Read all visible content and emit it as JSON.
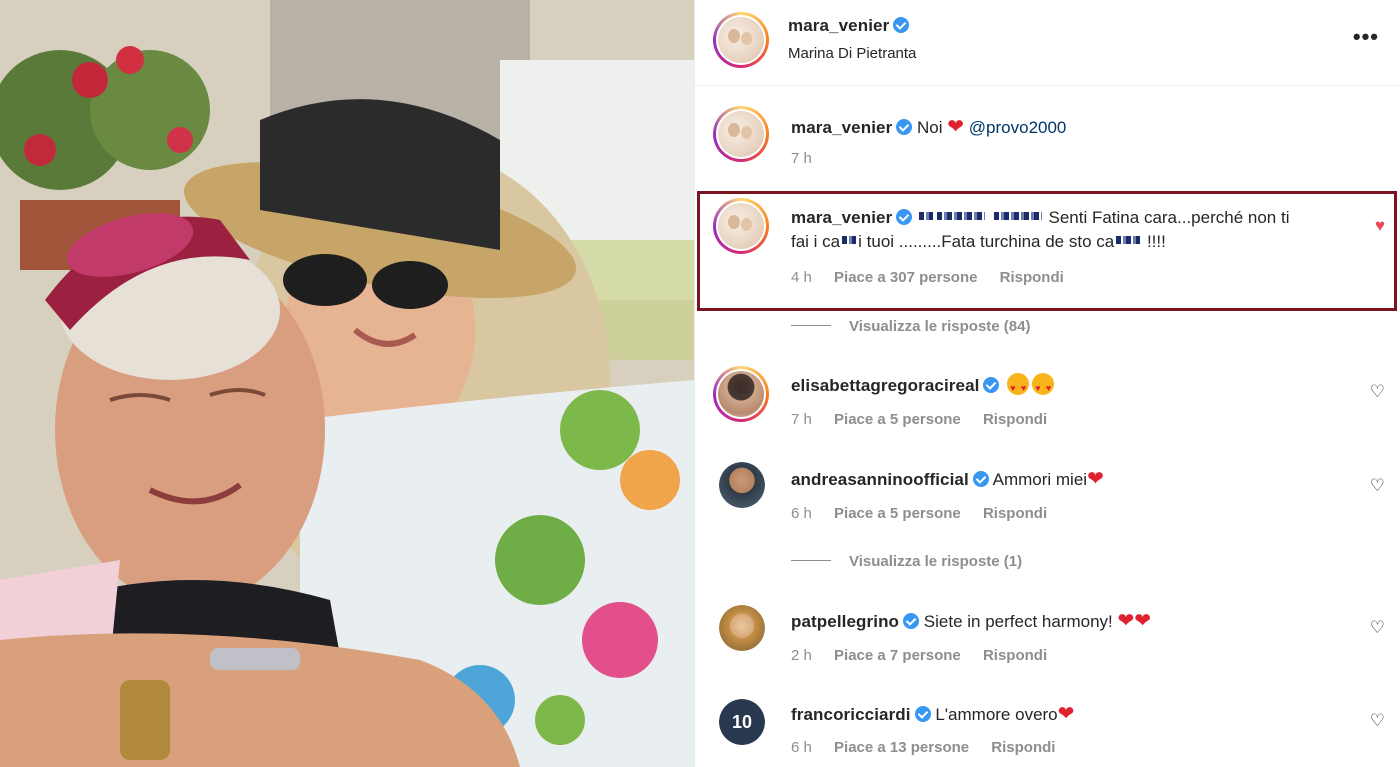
{
  "post": {
    "author": "mara_venier",
    "location": "Marina Di Pietranta",
    "more_label": "•••"
  },
  "comments": [
    {
      "user": "mara_venier",
      "text": "Noi",
      "mention": "@provo2000",
      "time": "7 h"
    },
    {
      "user": "mara_venier",
      "text_1": "Senti Fatina cara...perché non ti",
      "text_2a": "fai i ca",
      "text_2b": "i tuoi .........Fata turchina de sto ca",
      "text_2c": "!!!!",
      "time": "4 h",
      "likes": "Piace a 307 persone",
      "reply": "Rispondi",
      "view_replies": "Visualizza le risposte (84)"
    },
    {
      "user": "elisabettagregoracireal",
      "time": "7 h",
      "likes": "Piace a 5 persone",
      "reply": "Rispondi"
    },
    {
      "user": "andreasanninoofficial",
      "text": "Ammori miei",
      "time": "6 h",
      "likes": "Piace a 5 persone",
      "reply": "Rispondi",
      "view_replies": "Visualizza le risposte (1)"
    },
    {
      "user": "patpellegrino",
      "text": "Siete in perfect harmony!",
      "time": "2 h",
      "likes": "Piace a 7 persone",
      "reply": "Rispondi"
    },
    {
      "user": "francoricciardi",
      "text": "L'ammore overo",
      "avatar_text": "10",
      "time": "6 h",
      "likes": "Piace a 13 persone",
      "reply": "Rispondi"
    }
  ],
  "colors": {
    "highlight_border": "#7a1421",
    "verified": "#3897f0",
    "liked_heart": "#ed4956"
  },
  "icons": {
    "verified": "verified-badge-icon",
    "heart": "heart-icon",
    "more": "more-icon"
  }
}
